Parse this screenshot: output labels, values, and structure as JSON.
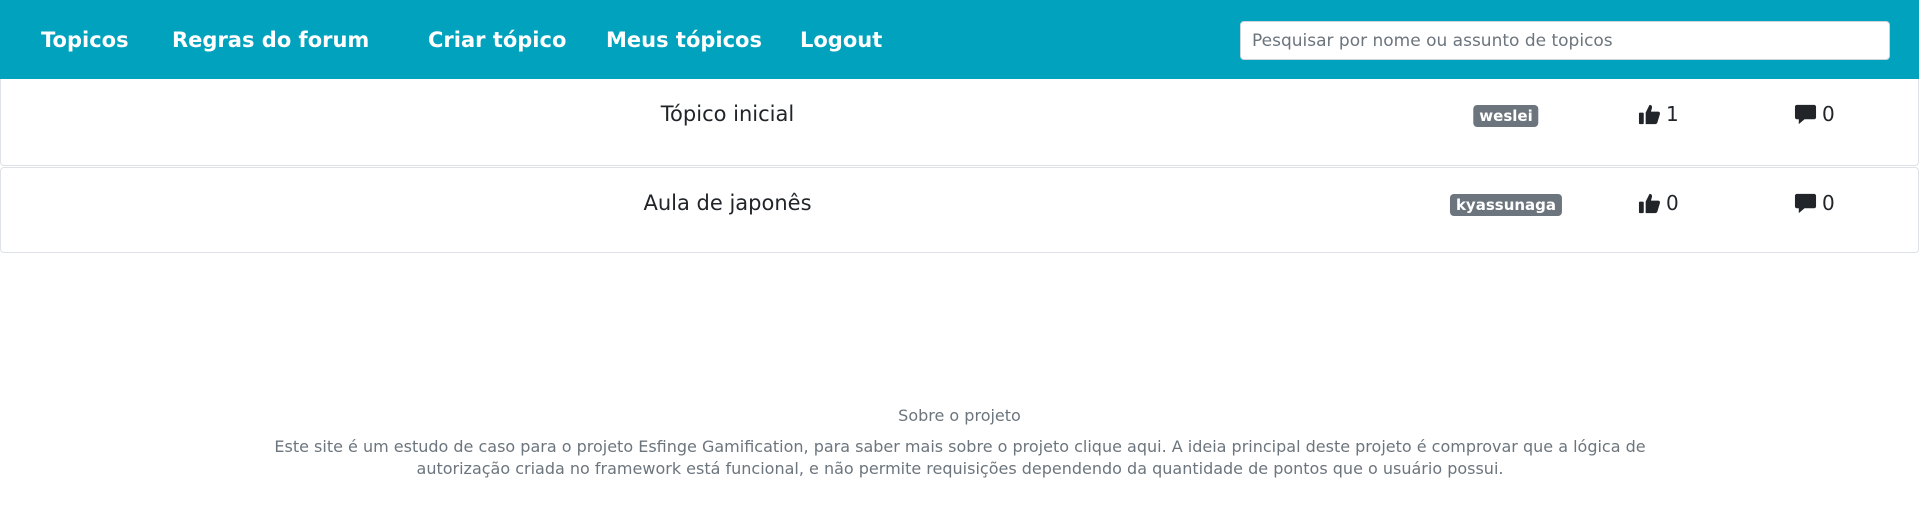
{
  "nav": {
    "items": [
      {
        "label": "Topicos"
      },
      {
        "label": "Regras do forum"
      },
      {
        "label": "Criar tópico"
      },
      {
        "label": "Meus tópicos"
      },
      {
        "label": "Logout"
      }
    ],
    "search_placeholder": "Pesquisar por nome ou assunto de topicos"
  },
  "topics": [
    {
      "title": "Tópico inicial",
      "author": "weslei",
      "likes": "1",
      "comments": "0"
    },
    {
      "title": "Aula de japonês",
      "author": "kyassunaga",
      "likes": "0",
      "comments": "0"
    }
  ],
  "icons": {
    "like": "thumbs-up-icon",
    "comment": "comment-icon"
  },
  "colors": {
    "navbar": "#00a2bd",
    "badge": "#6c757d"
  },
  "footer": {
    "title": "Sobre o projeto",
    "text": "Este site é um estudo de caso para o projeto Esfinge Gamification, para saber mais sobre o projeto clique aqui. A ideia principal deste projeto é comprovar que a lógica de autorização criada no framework está funcional, e não permite requisições dependendo da quantidade de pontos que o usuário possui."
  }
}
